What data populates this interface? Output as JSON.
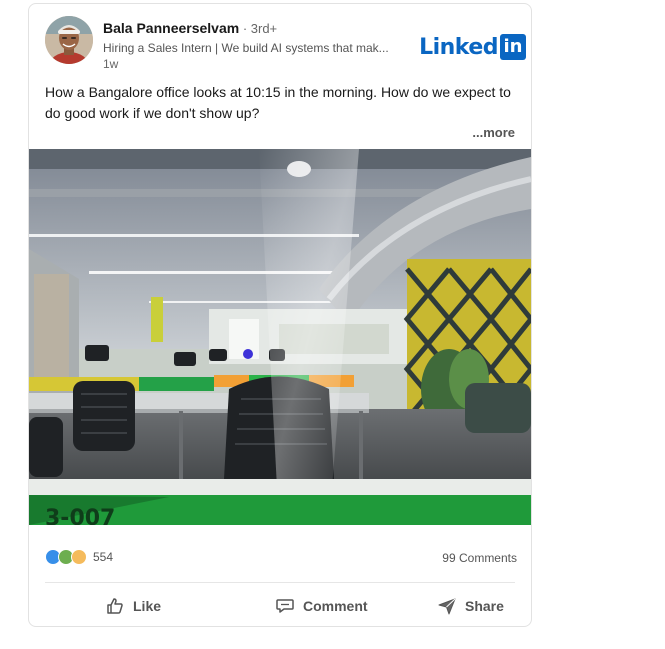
{
  "post": {
    "author": {
      "name": "Bala Panneerselvam",
      "degree": " · 3rd+",
      "headline": "Hiring a Sales Intern | We build AI systems that mak...",
      "time": "1w"
    },
    "brand": {
      "text": "Linked",
      "badge": "in"
    },
    "text": "How a Bangalore office looks at 10:15 in the morning. How do we expect to do good work if we don't show up?",
    "see_more": "...more",
    "image": {
      "desk_label": "3-007"
    },
    "social": {
      "reaction_icons": [
        "like-icon",
        "celebrate-icon",
        "insightful-icon"
      ],
      "reaction_count": "554",
      "comments": "99 Comments"
    },
    "actions": {
      "like": "Like",
      "comment": "Comment",
      "share": "Share"
    }
  },
  "colors": {
    "brand": "#0a66c2",
    "text": "#191919",
    "muted": "#555555",
    "desk_green": "#1f9a3a"
  }
}
